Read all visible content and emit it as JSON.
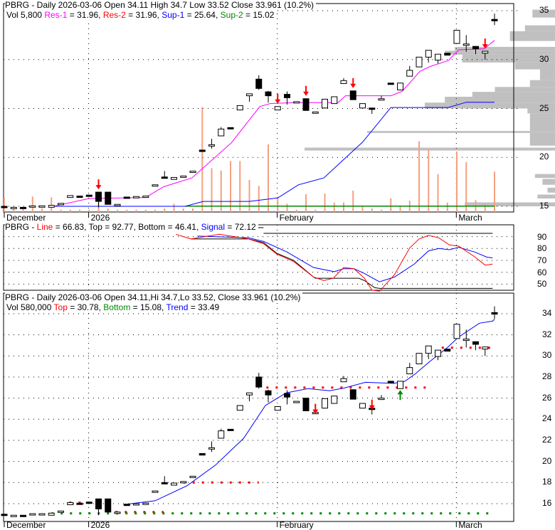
{
  "colors": {
    "res1": "#ff00ff",
    "res2": "#ff0000",
    "sup1": "#0000ff",
    "sup2": "#008800",
    "volume": "#f4a080",
    "profile": "#c0c0c0",
    "arrow_down": "#ff0000",
    "arrow_up": "#008800"
  },
  "chart_data": [
    {
      "type": "candlestick",
      "panel": "price-support-resistance",
      "title": "PBRG - Daily 2026-03-06 Open 34.11  High 34.7  Low 33.52  Close 33.961 (10.2%)",
      "legend": {
        "vol": "Vol 5,800",
        "res1_label": "Res-1",
        "res1_value": "= 31.96,",
        "res2_label": "Res-2",
        "res2_value": "= 31.96,",
        "sup1_label": "Sup-1",
        "sup1_value": "= 25.64,",
        "sup2_label": "Sup-2",
        "sup2_value": "= 15.02"
      },
      "x_labels": [
        {
          "label": "December",
          "i": 1
        },
        {
          "label": "2026",
          "i": 10.1
        },
        {
          "label": "February",
          "i": 30.1
        },
        {
          "label": "March",
          "i": 49.1
        }
      ],
      "y_ticks": [
        15,
        20,
        25,
        30,
        35
      ],
      "ylim": [
        14.4,
        35.7
      ],
      "candles_ohlc": [
        [
          15.0,
          15.0,
          14.95,
          14.95
        ],
        [
          14.9,
          14.9,
          14.9,
          14.9
        ],
        [
          14.9,
          14.9,
          14.82,
          14.82
        ],
        [
          15.05,
          15.05,
          15.05,
          15.05
        ],
        [
          15.05,
          15.05,
          15.05,
          15.05
        ],
        [
          14.9,
          15.1,
          14.9,
          15.1
        ],
        [
          15.3,
          15.3,
          15.3,
          15.3
        ],
        [
          15.9,
          16.1,
          15.9,
          16.1
        ],
        [
          16.05,
          16.05,
          15.95,
          15.95
        ],
        [
          16.15,
          16.15,
          16.05,
          16.05
        ],
        [
          16.45,
          16.45,
          14.9,
          15.5
        ],
        [
          16.45,
          16.45,
          15.2,
          15.2
        ],
        [
          15.2,
          15.2,
          15.2,
          15.2
        ],
        [
          15.95,
          15.95,
          15.85,
          15.85
        ],
        [
          16.0,
          16.0,
          16.0,
          16.0
        ],
        [
          16.05,
          16.05,
          16.05,
          16.05
        ],
        [
          17.2,
          17.2,
          17.2,
          17.2
        ],
        [
          18.0,
          18.6,
          17.9,
          17.9
        ],
        [
          17.75,
          17.95,
          17.75,
          17.95
        ],
        [
          18.1,
          18.1,
          18.1,
          18.1
        ],
        [
          18.6,
          18.6,
          18.6,
          18.6
        ],
        [
          20.75,
          20.75,
          20.6,
          20.6
        ],
        [
          21.3,
          21.9,
          20.9,
          21.3
        ],
        [
          22.2,
          23.1,
          22.2,
          22.9
        ],
        [
          23.05,
          23.05,
          22.95,
          22.95
        ],
        [
          24.85,
          25.3,
          24.85,
          25.3
        ],
        [
          26.3,
          26.5,
          25.7,
          26.5
        ],
        [
          28.0,
          28.4,
          26.9,
          27.05
        ],
        [
          26.7,
          26.8,
          25.6,
          26.3
        ],
        [
          24.85,
          25.2,
          24.85,
          25.2
        ],
        [
          26.45,
          26.75,
          25.4,
          26.1
        ],
        [
          25.7,
          25.7,
          25.7,
          25.7
        ],
        [
          26.0,
          26.0,
          24.8,
          24.8
        ],
        [
          24.65,
          24.65,
          24.65,
          24.65
        ],
        [
          25.05,
          25.95,
          25.0,
          25.95
        ],
        [
          25.5,
          26.2,
          25.5,
          26.2
        ],
        [
          27.55,
          28.1,
          27.55,
          27.85
        ],
        [
          26.8,
          26.8,
          25.9,
          25.9
        ],
        [
          25.05,
          25.5,
          25.05,
          25.5
        ],
        [
          25.05,
          25.05,
          24.45,
          25.0
        ],
        [
          26.0,
          26.3,
          26.0,
          26.0
        ],
        [
          27.6,
          27.6,
          27.5,
          27.5
        ],
        [
          26.9,
          27.6,
          26.9,
          27.6
        ],
        [
          28.3,
          29.35,
          28.3,
          28.9
        ],
        [
          29.25,
          30.25,
          29.25,
          30.25
        ],
        [
          30.25,
          30.95,
          29.7,
          30.95
        ],
        [
          29.95,
          30.55,
          29.6,
          30.55
        ],
        [
          30.65,
          30.65,
          30.45,
          30.45
        ],
        [
          31.65,
          33.0,
          31.65,
          33.0
        ],
        [
          31.6,
          32.5,
          30.8,
          31.6
        ],
        [
          31.35,
          31.35,
          30.55,
          31.1
        ],
        [
          30.65,
          30.85,
          30.0,
          30.85
        ],
        [
          34.11,
          34.7,
          33.52,
          33.961
        ]
      ],
      "volume_relative": [
        62,
        15,
        15,
        65,
        15,
        62,
        10,
        10,
        10,
        10,
        40,
        15,
        10,
        10,
        10,
        10,
        10,
        15,
        35,
        15,
        15,
        443,
        185,
        175,
        215,
        215,
        135,
        110,
        285,
        65,
        35,
        10,
        75,
        10,
        78,
        40,
        40,
        90,
        25,
        15,
        10,
        58,
        25,
        48,
        298,
        265,
        160,
        40,
        255,
        210,
        50,
        35,
        170
      ],
      "res1_line": [
        [
          6.2,
          15
        ],
        [
          10,
          15.8
        ],
        [
          16,
          15.9
        ],
        [
          17.9,
          17
        ],
        [
          20.9,
          17.9
        ],
        [
          25.1,
          21.5
        ],
        [
          28.1,
          25.2
        ],
        [
          29.2,
          25.5
        ],
        [
          31.9,
          25.6
        ],
        [
          36.4,
          25.6
        ],
        [
          37.2,
          26.3
        ],
        [
          42,
          26.3
        ],
        [
          43.2,
          26.75
        ],
        [
          45.1,
          28.8
        ],
        [
          46.2,
          29.3
        ],
        [
          48.1,
          29.9
        ],
        [
          49.2,
          31
        ],
        [
          51.9,
          31.1
        ],
        [
          53,
          31.96
        ]
      ],
      "sup1_line": [
        [
          6.2,
          15
        ],
        [
          20.2,
          15
        ],
        [
          22.1,
          15.5
        ],
        [
          27,
          15.5
        ],
        [
          30,
          15.85
        ],
        [
          32.2,
          17.2
        ],
        [
          34.9,
          17.9
        ],
        [
          36.8,
          19.6
        ],
        [
          39,
          21.55
        ],
        [
          42,
          25.1
        ],
        [
          48.1,
          25.1
        ],
        [
          50,
          25.64
        ],
        [
          53,
          25.64
        ]
      ],
      "sup2_line": [
        [
          20.2,
          15.02
        ],
        [
          53,
          15.02
        ]
      ],
      "down_arrows": [
        11,
        30,
        33,
        38,
        52
      ],
      "volume_profile": [
        {
          "lo": 34.3,
          "hi": 35.1,
          "rel": 0.09
        },
        {
          "lo": 32.9,
          "hi": 33.5,
          "rel": 0.12
        },
        {
          "lo": 31.9,
          "hi": 32.9,
          "rel": 0.18
        },
        {
          "lo": 30.9,
          "hi": 31.3,
          "rel": 0.4
        },
        {
          "lo": 30.5,
          "hi": 30.9,
          "rel": 0.44
        },
        {
          "lo": 29.7,
          "hi": 30.5,
          "rel": 0.37
        },
        {
          "lo": 29.0,
          "hi": 29.7,
          "rel": 0.16
        },
        {
          "lo": 27.9,
          "hi": 29.0,
          "rel": 0.06
        },
        {
          "lo": 27.2,
          "hi": 27.9,
          "rel": 0.1
        },
        {
          "lo": 26.7,
          "hi": 27.2,
          "rel": 0.24
        },
        {
          "lo": 26.2,
          "hi": 26.7,
          "rel": 0.33
        },
        {
          "lo": 25.6,
          "hi": 26.2,
          "rel": 0.44
        },
        {
          "lo": 25.0,
          "hi": 25.6,
          "rel": 0.52
        },
        {
          "lo": 24.5,
          "hi": 25.0,
          "rel": 0.11
        },
        {
          "lo": 22.7,
          "hi": 24.5,
          "rel": 0.1
        },
        {
          "lo": 22.5,
          "hi": 22.7,
          "rel": 0.75
        },
        {
          "lo": 21.2,
          "hi": 22.5,
          "rel": 0.1
        },
        {
          "lo": 20.7,
          "hi": 21.0,
          "rel": 1.0
        },
        {
          "lo": 17.9,
          "hi": 18.3,
          "rel": 0.08
        },
        {
          "lo": 17.2,
          "hi": 17.8,
          "rel": 0.05
        },
        {
          "lo": 16.4,
          "hi": 16.9,
          "rel": 0.03
        },
        {
          "lo": 15.8,
          "hi": 16.2,
          "rel": 0.07
        },
        {
          "lo": 15.0,
          "hi": 15.4,
          "rel": 0.36
        }
      ]
    },
    {
      "type": "line",
      "panel": "oscillator",
      "legend": {
        "prefix": "PBRG - ",
        "line_label": "Line",
        "line_value": "= 66.83, Top = 92.77, Bottom = 46.41,",
        "signal_label": "Signal",
        "signal_value": "= 72.12"
      },
      "y_ticks": [
        50,
        60,
        70,
        80,
        90
      ],
      "ylim": [
        40,
        100
      ],
      "top": 92.77,
      "bottom": 46.41,
      "line": [
        [
          19.2,
          92
        ],
        [
          20.8,
          88
        ],
        [
          23.8,
          92
        ],
        [
          26.9,
          88
        ],
        [
          28.5,
          84
        ],
        [
          29.9,
          75.3
        ],
        [
          31.7,
          69
        ],
        [
          33.8,
          56
        ],
        [
          34.9,
          53
        ],
        [
          35.9,
          55
        ],
        [
          37,
          64
        ],
        [
          38.1,
          63
        ],
        [
          39.2,
          55
        ],
        [
          40,
          45
        ],
        [
          40.8,
          44
        ],
        [
          42.4,
          58
        ],
        [
          44,
          80.5
        ],
        [
          45,
          88
        ],
        [
          46,
          91
        ],
        [
          47.1,
          89
        ],
        [
          48.2,
          83
        ],
        [
          49.2,
          82
        ],
        [
          50.9,
          73
        ],
        [
          52,
          66
        ],
        [
          52.8,
          66.83
        ]
      ],
      "signal": [
        [
          21.5,
          90.4
        ],
        [
          26.9,
          89
        ],
        [
          28.5,
          86
        ],
        [
          31,
          77
        ],
        [
          33.8,
          64
        ],
        [
          36,
          60.5
        ],
        [
          37,
          63
        ],
        [
          38.1,
          63
        ],
        [
          39.2,
          59
        ],
        [
          40.8,
          52
        ],
        [
          42.4,
          56
        ],
        [
          44.5,
          67
        ],
        [
          46,
          78
        ],
        [
          47.1,
          80
        ],
        [
          48.2,
          79
        ],
        [
          49.2,
          81
        ],
        [
          50.9,
          77
        ],
        [
          52.2,
          72.7
        ],
        [
          52.8,
          72.12
        ]
      ],
      "bottom_track": [
        [
          20.8,
          88
        ],
        [
          26.9,
          88
        ],
        [
          28.5,
          85
        ],
        [
          29.9,
          76
        ],
        [
          31.7,
          70
        ],
        [
          33.8,
          56
        ],
        [
          34,
          55
        ],
        [
          38.6,
          55
        ],
        [
          39.2,
          53
        ],
        [
          40.3,
          47
        ],
        [
          40.8,
          46.41
        ],
        [
          52.8,
          46.41
        ]
      ],
      "top_track": [
        [
          28.5,
          92.77
        ],
        [
          52.8,
          92.77
        ]
      ]
    },
    {
      "type": "candlestick",
      "panel": "price-trend",
      "title": "PBRG - Daily 2026-03-06 Open 34.11,Hi 34.7,Lo 33.52, Close 33.961 (10.2%)",
      "legend": {
        "vol": "Vol 580,000",
        "top_label": "Top",
        "top_value": "= 30.78,",
        "bottom_label": "Bottom",
        "bottom_value": "= 15.08,",
        "trend_label": "Trend",
        "trend_value": "= 33.49"
      },
      "y_ticks": [
        16,
        18,
        20,
        22,
        24,
        26,
        28,
        30,
        32,
        34
      ],
      "ylim": [
        14.6,
        35.0
      ],
      "trend": [
        [
          13.8,
          15.93
        ],
        [
          17,
          16.27
        ],
        [
          20.4,
          17.7
        ],
        [
          23.4,
          19.65
        ],
        [
          26.4,
          22.2
        ],
        [
          28.7,
          25.3
        ],
        [
          30.9,
          26.5
        ],
        [
          33.2,
          26.9
        ],
        [
          35.5,
          26.7
        ],
        [
          37,
          26.95
        ],
        [
          39.3,
          27.5
        ],
        [
          40.8,
          27.45
        ],
        [
          42.3,
          27.4
        ],
        [
          43.5,
          27.6
        ],
        [
          44.6,
          28.3
        ],
        [
          46.1,
          29.45
        ],
        [
          48,
          30.8
        ],
        [
          49.2,
          31.8
        ],
        [
          51.4,
          33.1
        ],
        [
          52.8,
          33.3
        ],
        [
          53,
          33.49
        ]
      ],
      "top_levels": [
        [
          7.9,
          10.4,
          16.1
        ],
        [
          12.8,
          17.9,
          15.2
        ],
        [
          20,
          28,
          18
        ],
        [
          28.8,
          46,
          27
        ],
        [
          47.4,
          53,
          30.78
        ]
      ],
      "bottom_levels": [
        [
          6,
          53,
          15.08
        ]
      ],
      "down_arrows": [
        34,
        40
      ],
      "up_arrows": [
        43
      ]
    }
  ]
}
